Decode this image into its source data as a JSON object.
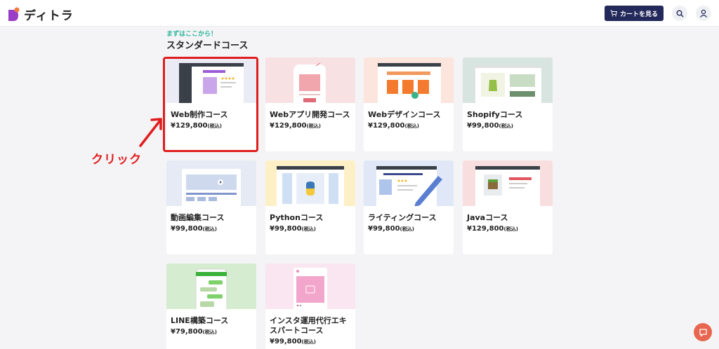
{
  "header": {
    "logo_text": "ディトラ",
    "cart_label": "カートを見る",
    "icons": {
      "cart": "cart-icon",
      "search": "search-icon",
      "user": "user-icon"
    }
  },
  "section": {
    "subtitle": "まずはここから！",
    "title": "スタンダードコース"
  },
  "courses": [
    {
      "title": "Web制作コース",
      "price": "¥129,800",
      "tax": "(税込)",
      "thumb_color": "#ebebf6"
    },
    {
      "title": "Webアプリ開発コース",
      "price": "¥129,800",
      "tax": "(税込)",
      "thumb_color": "#f8e1e2"
    },
    {
      "title": "Webデザインコース",
      "price": "¥129,800",
      "tax": "(税込)",
      "thumb_color": "#fbe5dc"
    },
    {
      "title": "Shopifyコース",
      "price": "¥99,800",
      "tax": "(税込)",
      "thumb_color": "#d8e4e0"
    },
    {
      "title": "動画編集コース",
      "price": "¥99,800",
      "tax": "(税込)",
      "thumb_color": "#e6eaf4"
    },
    {
      "title": "Pythonコース",
      "price": "¥99,800",
      "tax": "(税込)",
      "thumb_color": "#fdf0c6"
    },
    {
      "title": "ライティングコース",
      "price": "¥99,800",
      "tax": "(税込)",
      "thumb_color": "#e0e8f8"
    },
    {
      "title": "Javaコース",
      "price": "¥129,800",
      "tax": "(税込)",
      "thumb_color": "#f9dedf"
    },
    {
      "title": "LINE構築コース",
      "price": "¥79,800",
      "tax": "(税込)",
      "thumb_color": "#d6ecd0"
    },
    {
      "title": "インスタ運用代行エキスパートコース",
      "price": "¥99,800",
      "tax": "(税込)",
      "thumb_color": "#f9e6f0"
    }
  ],
  "annotation": {
    "click_text": "クリック",
    "color": "#e01d1d"
  },
  "colors": {
    "accent_green": "#2bb39a",
    "cart_button": "#23295a",
    "chat_button": "#e8664f"
  }
}
